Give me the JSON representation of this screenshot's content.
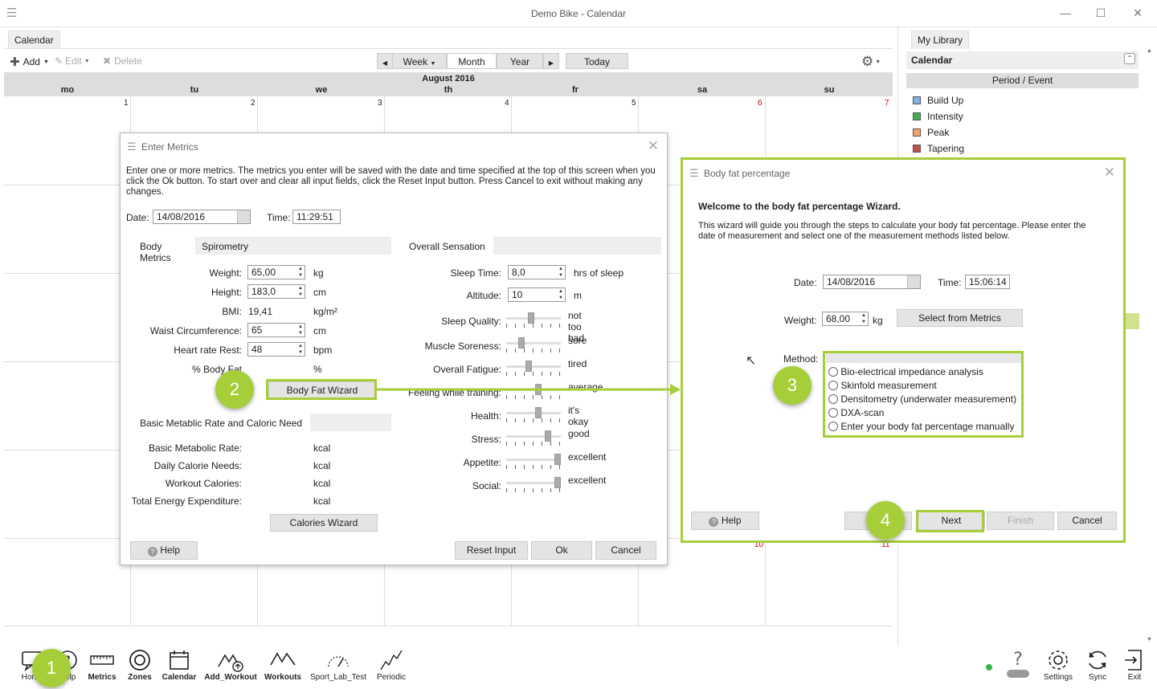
{
  "window": {
    "title": "Demo Bike - Calendar"
  },
  "tabs": {
    "calendar": "Calendar",
    "library": "My Library"
  },
  "toolbar": {
    "add": "Add",
    "edit": "Edit",
    "delete": "Delete",
    "week": "Week",
    "month": "Month",
    "year": "Year",
    "today": "Today"
  },
  "calendar": {
    "month_title": "August 2016",
    "days": [
      "mo",
      "tu",
      "we",
      "th",
      "fr",
      "sa",
      "su"
    ],
    "first_row": [
      "1",
      "2",
      "3",
      "4",
      "5",
      "6",
      "7"
    ],
    "row_partial": [
      "10",
      "11"
    ]
  },
  "library": {
    "section": "Calendar",
    "table_header": "Period / Event",
    "items": [
      {
        "label": "Build Up",
        "color": "#7fb2e5"
      },
      {
        "label": "Intensity",
        "color": "#3cb44b"
      },
      {
        "label": "Peak",
        "color": "#f5a36c"
      },
      {
        "label": "Tapering",
        "color": "#c0504d"
      }
    ]
  },
  "metrics_dialog": {
    "title": "Enter Metrics",
    "intro": "Enter one or more metrics. The metrics you enter will be saved with the date and time specified at the top of this screen when you click the Ok button. To start over and clear all input fields, click the Reset Input button. Press Cancel to exit without making any changes.",
    "date_label": "Date:",
    "date_value": "14/08/2016",
    "time_label": "Time:",
    "time_value": "11:29:51",
    "tab_body": "Body Metrics",
    "tab_spiro": "Spirometry",
    "weight_label": "Weight:",
    "weight_value": "65,00",
    "weight_unit": "kg",
    "height_label": "Height:",
    "height_value": "183,0",
    "height_unit": "cm",
    "bmi_label": "BMI:",
    "bmi_value": "19,41",
    "bmi_unit": "kg/m²",
    "waist_label": "Waist Circumference:",
    "waist_value": "65",
    "waist_unit": "cm",
    "hr_label": "Heart rate Rest:",
    "hr_value": "48",
    "hr_unit": "bpm",
    "bodyfat_label": "% Body Fat",
    "bodyfat_unit": "%",
    "bodyfat_button": "Body Fat Wizard",
    "bmr_section": "Basic Metablic Rate and Caloric Need",
    "bmr_label": "Basic Metabolic Rate:",
    "bmr_unit": "kcal",
    "daily_label": "Daily Calorie Needs:",
    "daily_unit": "kcal",
    "workout_label": "Workout Calories:",
    "workout_unit": "kcal",
    "total_label": "Total Energy Expenditure:",
    "total_unit": "kcal",
    "calories_button": "Calories Wizard",
    "overall_section": "Overall Sensation",
    "sleep_time_label": "Sleep Time:",
    "sleep_time_value": "8,0",
    "sleep_time_unit": "hrs of sleep",
    "altitude_label": "Altitude:",
    "altitude_value": "10",
    "altitude_unit": "m",
    "sliders": [
      {
        "label": "Sleep Quality:",
        "value": "not too bad",
        "level": 0.45
      },
      {
        "label": "Muscle Soreness:",
        "value": "sore",
        "level": 0.25
      },
      {
        "label": "Overall Fatigue:",
        "value": "tired",
        "level": 0.4
      },
      {
        "label": "Feeling while training:",
        "value": "average",
        "level": 0.6
      },
      {
        "label": "Health:",
        "value": "it's okay",
        "level": 0.6
      },
      {
        "label": "Stress:",
        "value": "good",
        "level": 0.8
      },
      {
        "label": "Appetite:",
        "value": "excellent",
        "level": 1.0
      },
      {
        "label": "Social:",
        "value": "excellent",
        "level": 1.0
      }
    ],
    "help": "Help",
    "reset": "Reset Input",
    "ok": "Ok",
    "cancel": "Cancel"
  },
  "wizard": {
    "title": "Body fat percentage",
    "heading": "Welcome to the body fat percentage Wizard.",
    "intro": "This wizard will guide you through the steps to calculate your body fat percentage. Please enter the date of measurement and select one of the measurement methods listed below.",
    "date_label": "Date:",
    "date_value": "14/08/2016",
    "time_label": "Time:",
    "time_value": "15:06:14",
    "weight_label": "Weight:",
    "weight_value": "68,00",
    "weight_unit": "kg",
    "select_button": "Select from Metrics",
    "method_label": "Method:",
    "methods": [
      "Bio-electrical impedance analysis",
      "Skinfold measurement",
      "Densitometry (underwater measurement)",
      "DXA-scan",
      "Enter your body fat percentage manually"
    ],
    "help": "Help",
    "next": "Next",
    "finish": "Finish",
    "cancel": "Cancel"
  },
  "callouts": [
    "1",
    "2",
    "3",
    "4"
  ],
  "bottom_toolbar": {
    "items": [
      "Home",
      "Help",
      "Metrics",
      "Zones",
      "Calendar",
      "Add_Workout",
      "Workouts",
      "Sport_Lab_Test",
      "Periodic"
    ],
    "right_items": [
      "Settings",
      "Sync",
      "Exit"
    ]
  },
  "accent_color": "#a6ce39"
}
